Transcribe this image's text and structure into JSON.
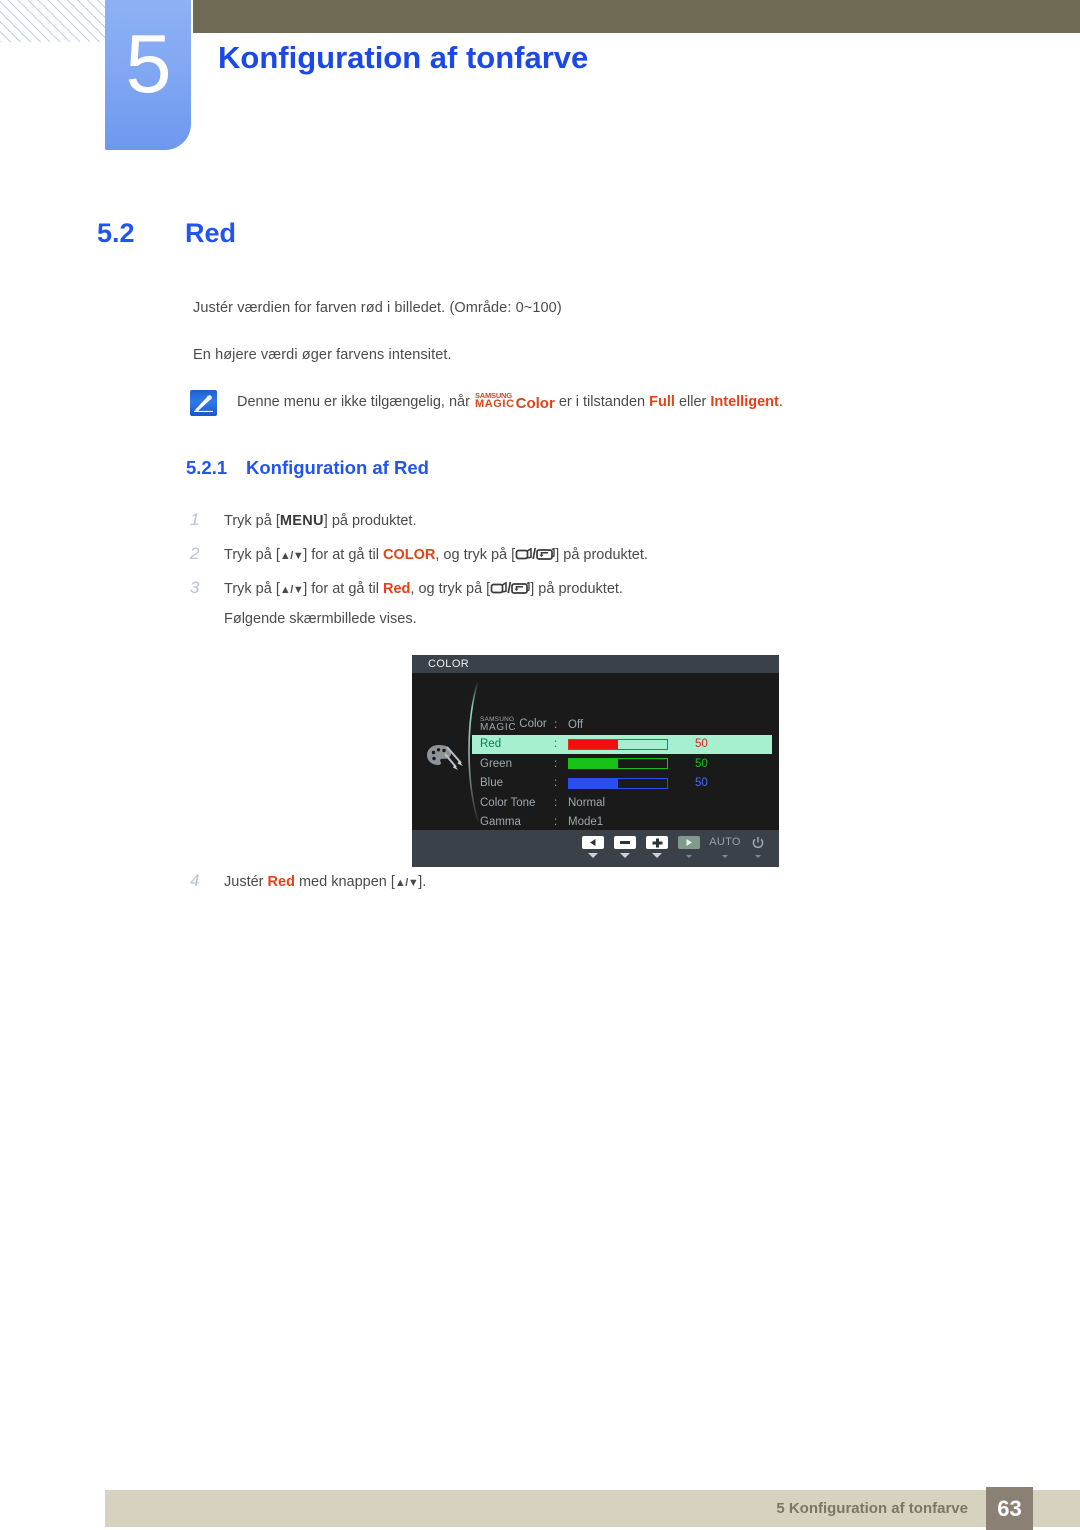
{
  "header": {
    "chapter_number": "5",
    "chapter_title": "Konfiguration af tonfarve",
    "accent_blue": "#1a49e8",
    "olive": "#6e6a54",
    "block_blue": "#82a8f3"
  },
  "section": {
    "number": "5.2",
    "title": "Red",
    "paragraph_1": "Justér værdien for farven rød i billedet. (Område: 0~100)",
    "paragraph_2": "En højere værdi øger farvens intensitet."
  },
  "note": {
    "icon": "note-pen-icon",
    "text_before": "Denne menu er ikke tilgængelig, når",
    "magic_line1": "SAMSUNG",
    "magic_line2": "MAGIC",
    "magic_color": "Color",
    "text_middle": "er i tilstanden",
    "keyword_1": "Full",
    "text_between": "eller",
    "keyword_2": "Intelligent",
    "text_end": ".",
    "keyword_color": "#e34316"
  },
  "subsection": {
    "number": "5.2.1",
    "title": "Konfiguration af Red"
  },
  "steps": [
    {
      "n": "1",
      "a": "Tryk på [",
      "kbd": "MENU",
      "b": "] på produktet."
    },
    {
      "n": "2",
      "a": "Tryk på [",
      "keys": "▲/▼",
      "b": "] for at gå til",
      "kw": "COLOR",
      "c": ", og tryk på [",
      "d": "] på produktet."
    },
    {
      "n": "3",
      "a": "Tryk på [",
      "keys": "▲/▼",
      "b": "] for at gå til",
      "kw": "Red",
      "c": ", og tryk på [",
      "d": "] på produktet."
    }
  ],
  "step3_followup": "Følgende skærmbillede vises.",
  "step4": {
    "n": "4",
    "a": "Justér",
    "kw": "Red",
    "b": "med knappen [",
    "keys": "▲/▼",
    "c": "]."
  },
  "osd": {
    "title": "COLOR",
    "palette_icon": "palette-icon",
    "rows": [
      {
        "type": "text",
        "label_line1": "SAMSUNG",
        "label_line2": "MAGIC",
        "label_suffix": "Color",
        "colon": ":",
        "value": "Off",
        "highlight": false
      },
      {
        "type": "slider",
        "label": "Red",
        "colon": ":",
        "value": "50",
        "fill_percent": 50,
        "color": "#f01010",
        "border": "#ff2020",
        "highlight": true
      },
      {
        "type": "slider",
        "label": "Green",
        "colon": ":",
        "value": "50",
        "fill_percent": 50,
        "color": "#16c316",
        "border": "#16c316",
        "highlight": false
      },
      {
        "type": "slider",
        "label": "Blue",
        "colon": ":",
        "value": "50",
        "fill_percent": 50,
        "color": "#2b4ef0",
        "border": "#2b4ef0",
        "highlight": false
      },
      {
        "type": "text",
        "label": "Color Tone",
        "colon": ":",
        "value": "Normal",
        "highlight": false
      },
      {
        "type": "text",
        "label": "Gamma",
        "colon": ":",
        "value": "Mode1",
        "highlight": false
      }
    ],
    "buttons": [
      {
        "name": "left-arrow-button",
        "glyph": "◀",
        "selected": false
      },
      {
        "name": "minus-button",
        "glyph": "▬",
        "selected": false
      },
      {
        "name": "plus-button",
        "glyph": "✚",
        "selected": false
      },
      {
        "name": "right-arrow-button",
        "glyph": "▶",
        "selected": true
      },
      {
        "name": "auto-button",
        "label": "AUTO",
        "selected": false
      },
      {
        "name": "power-button",
        "glyph": "⏻",
        "selected": false
      }
    ]
  },
  "footer": {
    "text": "5 Konfiguration af tonfarve",
    "page": "63"
  }
}
